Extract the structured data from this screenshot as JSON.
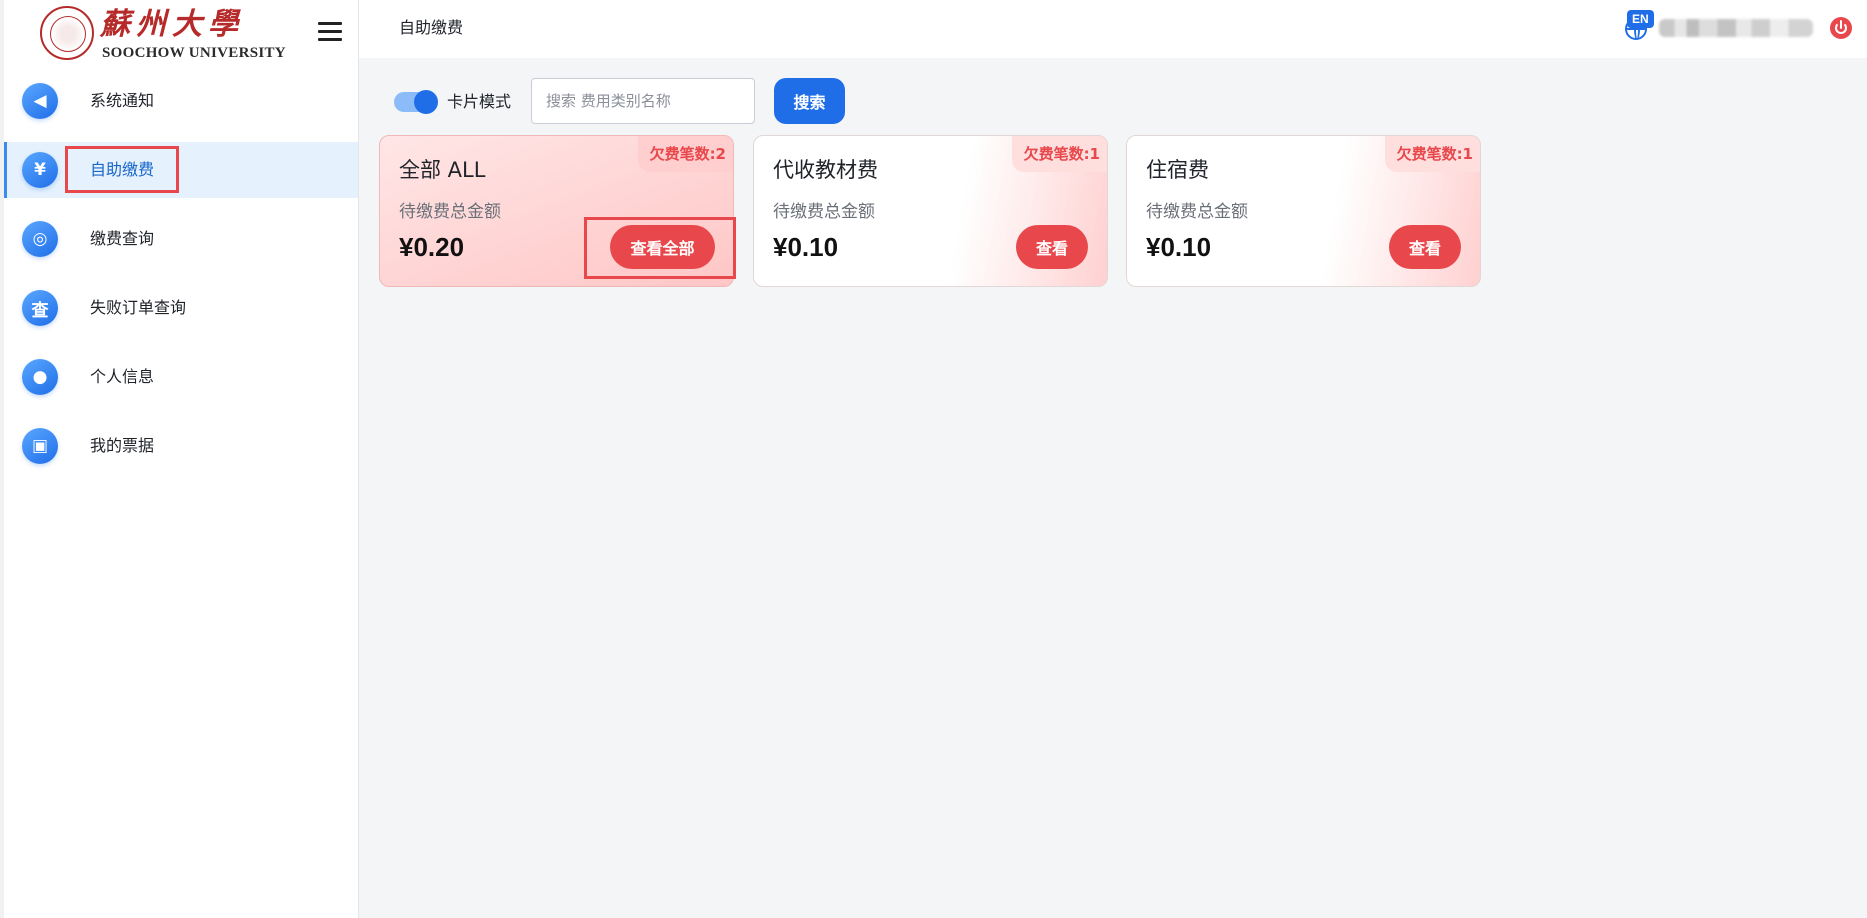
{
  "sidebar": {
    "logo_cn": "蘇州大學",
    "logo_en": "SOOCHOW UNIVERSITY",
    "items": [
      {
        "label": "系统通知",
        "icon": "speaker-icon",
        "glyph": "◀"
      },
      {
        "label": "自助缴费",
        "icon": "yen-coin-icon",
        "glyph": "¥"
      },
      {
        "label": "缴费查询",
        "icon": "target-icon",
        "glyph": "◎"
      },
      {
        "label": "失败订单查询",
        "icon": "search-doc-icon",
        "glyph": "查"
      },
      {
        "label": "个人信息",
        "icon": "user-icon",
        "glyph": "●"
      },
      {
        "label": "我的票据",
        "icon": "ticket-icon",
        "glyph": "▣"
      }
    ]
  },
  "header": {
    "breadcrumb": "自助缴费",
    "lang_badge": "EN"
  },
  "toolbar": {
    "mode_label": "卡片模式",
    "search_placeholder": "搜索 费用类别名称",
    "search_value": "",
    "search_button": "搜索"
  },
  "cards": [
    {
      "title": "全部 ALL",
      "badge": "欠费笔数:2",
      "subtitle": "待缴费总金额",
      "amount": "¥0.20",
      "button": "查看全部"
    },
    {
      "title": "代收教材费",
      "badge": "欠费笔数:1",
      "subtitle": "待缴费总金额",
      "amount": "¥0.10",
      "button": "查看"
    },
    {
      "title": "住宿费",
      "badge": "欠费笔数:1",
      "subtitle": "待缴费总金额",
      "amount": "¥0.10",
      "button": "查看"
    }
  ],
  "colors": {
    "primary": "#1f6ee8",
    "danger": "#e8484b",
    "active_nav_bg": "#e5f1fd",
    "highlight_box": "#e8484b"
  }
}
